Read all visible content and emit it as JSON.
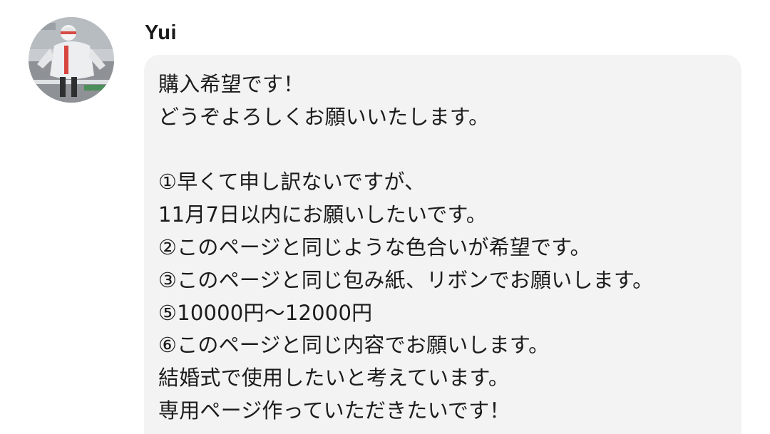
{
  "message": {
    "sender_name": "Yui",
    "lines": [
      "購入希望です！",
      "どうぞよろしくお願いいたします。",
      "",
      "①早くて申し訳ないですが、",
      "11月7日以内にお願いしたいです。",
      "②このページと同じような色合いが希望です。",
      "③このページと同じ包み紙、リボンでお願いします。",
      "⑤10000円〜12000円",
      "⑥このページと同じ内容でお願いします。",
      "結婚式で使用したいと考えています。",
      "専用ページ作っていただきたいです！"
    ]
  },
  "colors": {
    "bubble_background": "#f3f3f3",
    "text": "#1c1c1c",
    "page_background": "#ffffff"
  }
}
